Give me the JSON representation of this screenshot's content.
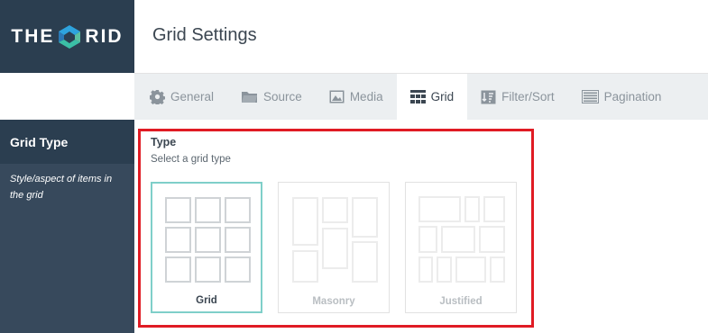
{
  "logo": {
    "text_left": "THE",
    "text_right": "RID",
    "colors": {
      "mark_top": "#2ea3dd",
      "mark_bottom": "#3bbfa6"
    }
  },
  "header": {
    "title": "Grid Settings"
  },
  "tabs": [
    {
      "label": "General",
      "icon": "gear-icon"
    },
    {
      "label": "Source",
      "icon": "folder-icon"
    },
    {
      "label": "Media",
      "icon": "image-icon"
    },
    {
      "label": "Grid",
      "icon": "grid-icon",
      "active": true
    },
    {
      "label": "Filter/Sort",
      "icon": "filter-sort-icon"
    },
    {
      "label": "Pagination",
      "icon": "pagination-icon"
    }
  ],
  "sidebar": {
    "title": "Grid Type",
    "description": "Style/aspect of items in the grid"
  },
  "field": {
    "label": "Type",
    "help": "Select a grid type"
  },
  "grid_types": [
    {
      "label": "Grid",
      "selected": true
    },
    {
      "label": "Masonry",
      "selected": false
    },
    {
      "label": "Justified",
      "selected": false
    }
  ],
  "colors": {
    "dark_navy": "#2b3e50",
    "sidebar": "#37495c",
    "selected_border": "#7fcfc9",
    "highlight": "#e01b24"
  }
}
